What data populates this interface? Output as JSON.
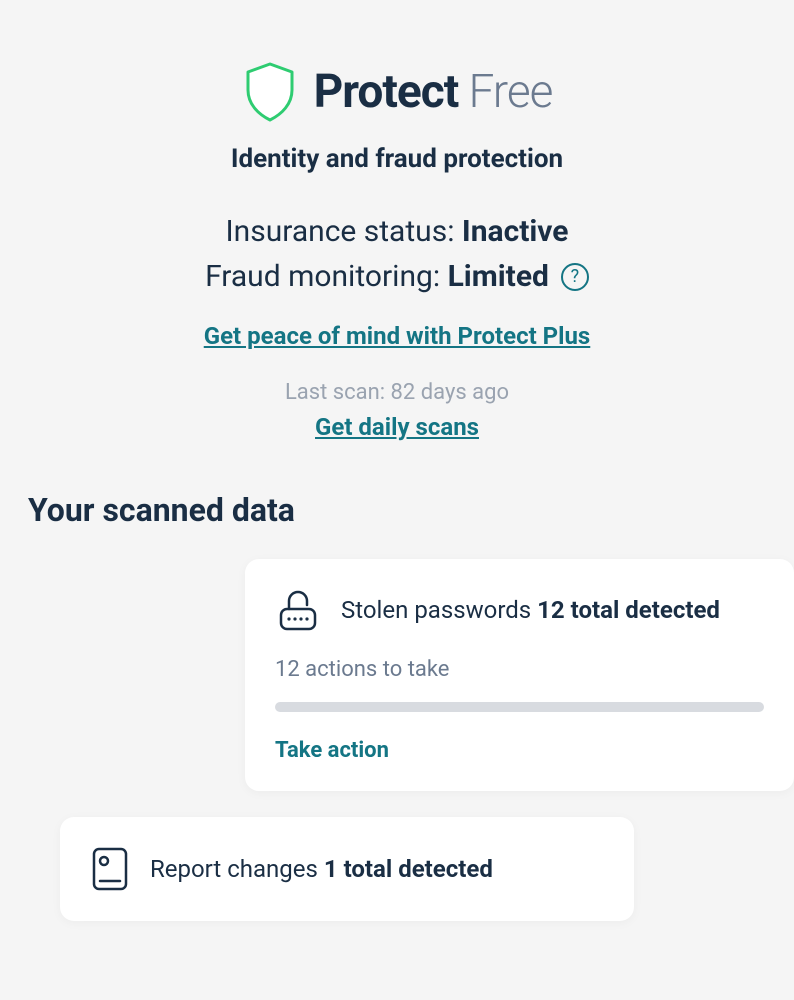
{
  "header": {
    "title_bold": "Protect",
    "title_light": " Free",
    "subtitle": "Identity and fraud protection"
  },
  "status": {
    "insurance_label": "Insurance status: ",
    "insurance_value": "Inactive",
    "fraud_label": "Fraud monitoring: ",
    "fraud_value": "Limited",
    "help_glyph": "?"
  },
  "links": {
    "upsell": "Get peace of mind with Protect Plus",
    "last_scan": "Last scan: 82 days ago",
    "daily_scans": "Get daily scans"
  },
  "section": {
    "title": "Your scanned data"
  },
  "cards": {
    "passwords": {
      "label": "Stolen passwords ",
      "detected": "12 total detected",
      "actions": "12 actions to take",
      "cta": "Take action"
    },
    "reports": {
      "label": "Report changes ",
      "detected": "1 total detected"
    }
  }
}
